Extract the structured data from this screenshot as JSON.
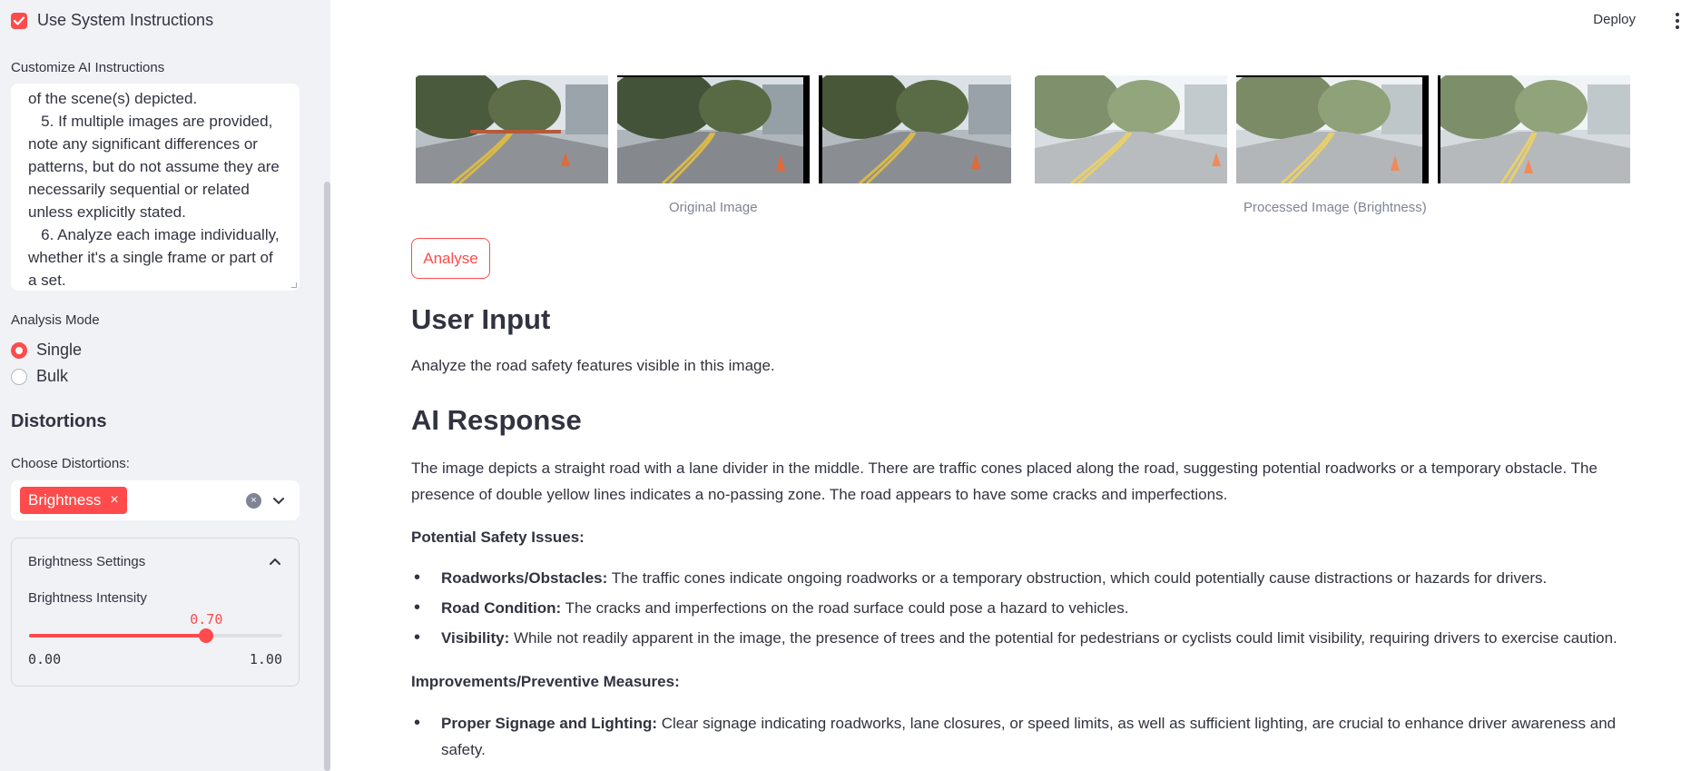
{
  "sidebar": {
    "use_system_instructions": {
      "label": "Use System Instructions",
      "checked": true
    },
    "customize_label": "Customize AI Instructions",
    "instructions_text": "of the scene(s) depicted.\n   5. If multiple images are provided, note any significant differences or patterns, but do not assume they are necessarily sequential or related unless explicitly stated.\n   6. Analyze each image individually, whether it's a single frame or part of a set.",
    "analysis_mode": {
      "label": "Analysis Mode",
      "options": [
        {
          "label": "Single",
          "selected": true
        },
        {
          "label": "Bulk",
          "selected": false
        }
      ]
    },
    "distortions_heading": "Distortions",
    "choose_label": "Choose Distortions:",
    "selected_distortions": [
      "Brightness"
    ],
    "tag_remove": "×",
    "clear_icon": "×",
    "brightness_settings": {
      "title": "Brightness Settings",
      "slider_label": "Brightness Intensity",
      "value": 0.7,
      "value_text": "0.70",
      "min_text": "0.00",
      "max_text": "1.00"
    }
  },
  "header": {
    "deploy_label": "Deploy"
  },
  "main": {
    "original_caption": "Original Image",
    "processed_caption": "Processed Image (Brightness)",
    "analyse_label": "Analyse",
    "user_input_heading": "User Input",
    "user_input_text": "Analyze the road safety features visible in this image.",
    "ai_response_heading": "AI Response",
    "ai_response_intro": "The image depicts a straight road with a lane divider in the middle. There are traffic cones placed along the road, suggesting potential roadworks or a temporary obstacle. The presence of double yellow lines indicates a no-passing zone. The road appears to have some cracks and imperfections.",
    "safety_issues_heading": "Potential Safety Issues:",
    "safety_issues": [
      {
        "title": "Roadworks/Obstacles:",
        "text": " The traffic cones indicate ongoing roadworks or a temporary obstruction, which could potentially cause distractions or hazards for drivers."
      },
      {
        "title": "Road Condition:",
        "text": " The cracks and imperfections on the road surface could pose a hazard to vehicles."
      },
      {
        "title": "Visibility:",
        "text": " While not readily apparent in the image, the presence of trees and the potential for pedestrians or cyclists could limit visibility, requiring drivers to exercise caution."
      }
    ],
    "improvements_heading": "Improvements/Preventive Measures:",
    "improvements": [
      {
        "title": "Proper Signage and Lighting:",
        "text": " Clear signage indicating roadworks, lane closures, or speed limits, as well as sufficient lighting, are crucial to enhance driver awareness and safety."
      }
    ]
  },
  "colors": {
    "accent": "#ff4b4b",
    "sidebar_bg": "#f0f2f6",
    "text": "#31333f",
    "caption": "#808495"
  },
  "icons": {
    "checkbox": "check-icon",
    "tag_remove": "close-icon",
    "clear": "clear-circle-icon",
    "dropdown": "chevron-down-icon",
    "expander": "chevron-up-icon",
    "menu": "kebab-menu-icon"
  }
}
